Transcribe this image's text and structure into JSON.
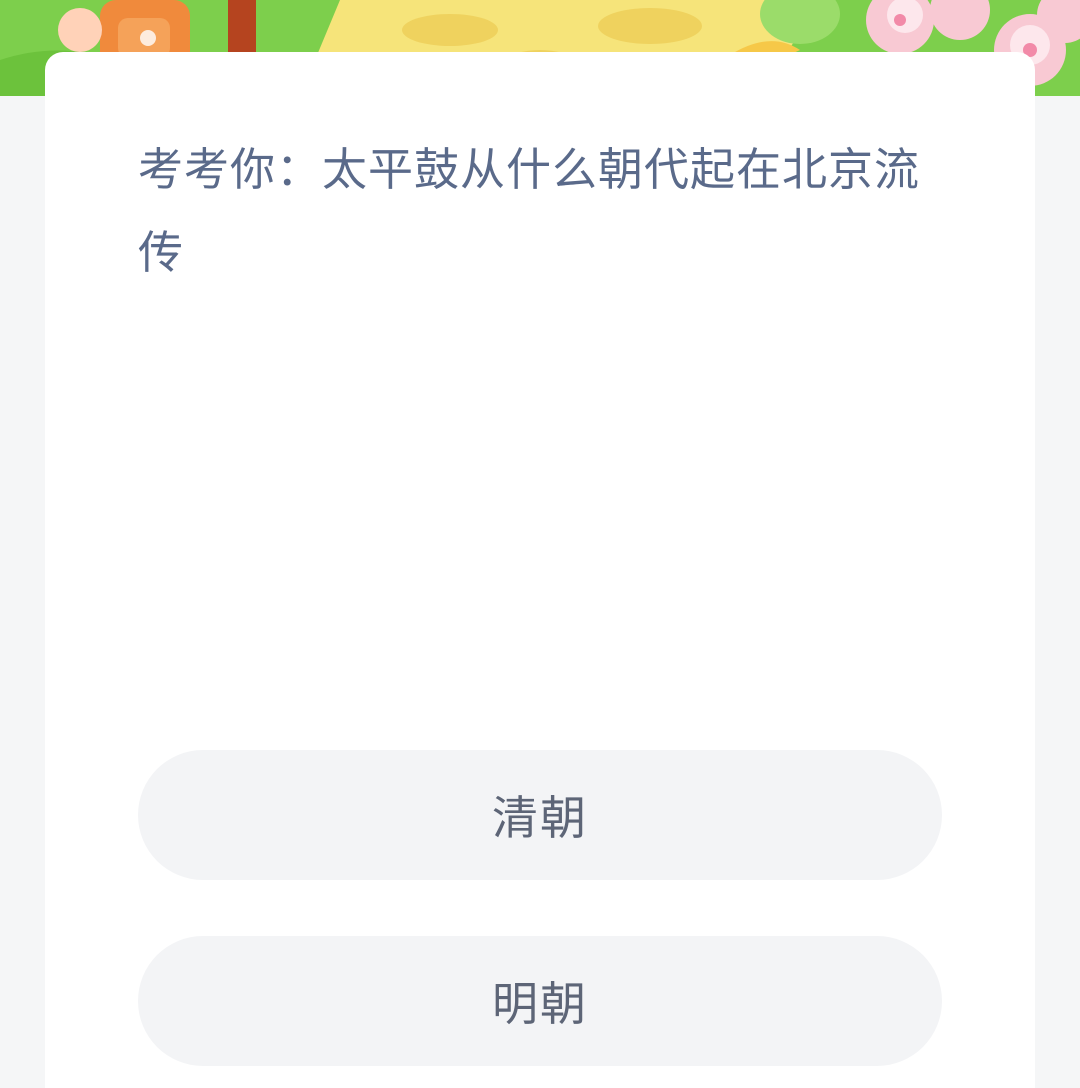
{
  "question": {
    "text": "考考你：太平鼓从什么朝代起在北京流传"
  },
  "options": [
    {
      "label": "清朝"
    },
    {
      "label": "明朝"
    }
  ],
  "colors": {
    "page_background": "#f5f6f7",
    "card_background": "#ffffff",
    "question_text": "#5a6a8a",
    "option_background": "#f3f4f6",
    "option_text": "#5d6577",
    "banner_green": "#7ccf4a"
  }
}
